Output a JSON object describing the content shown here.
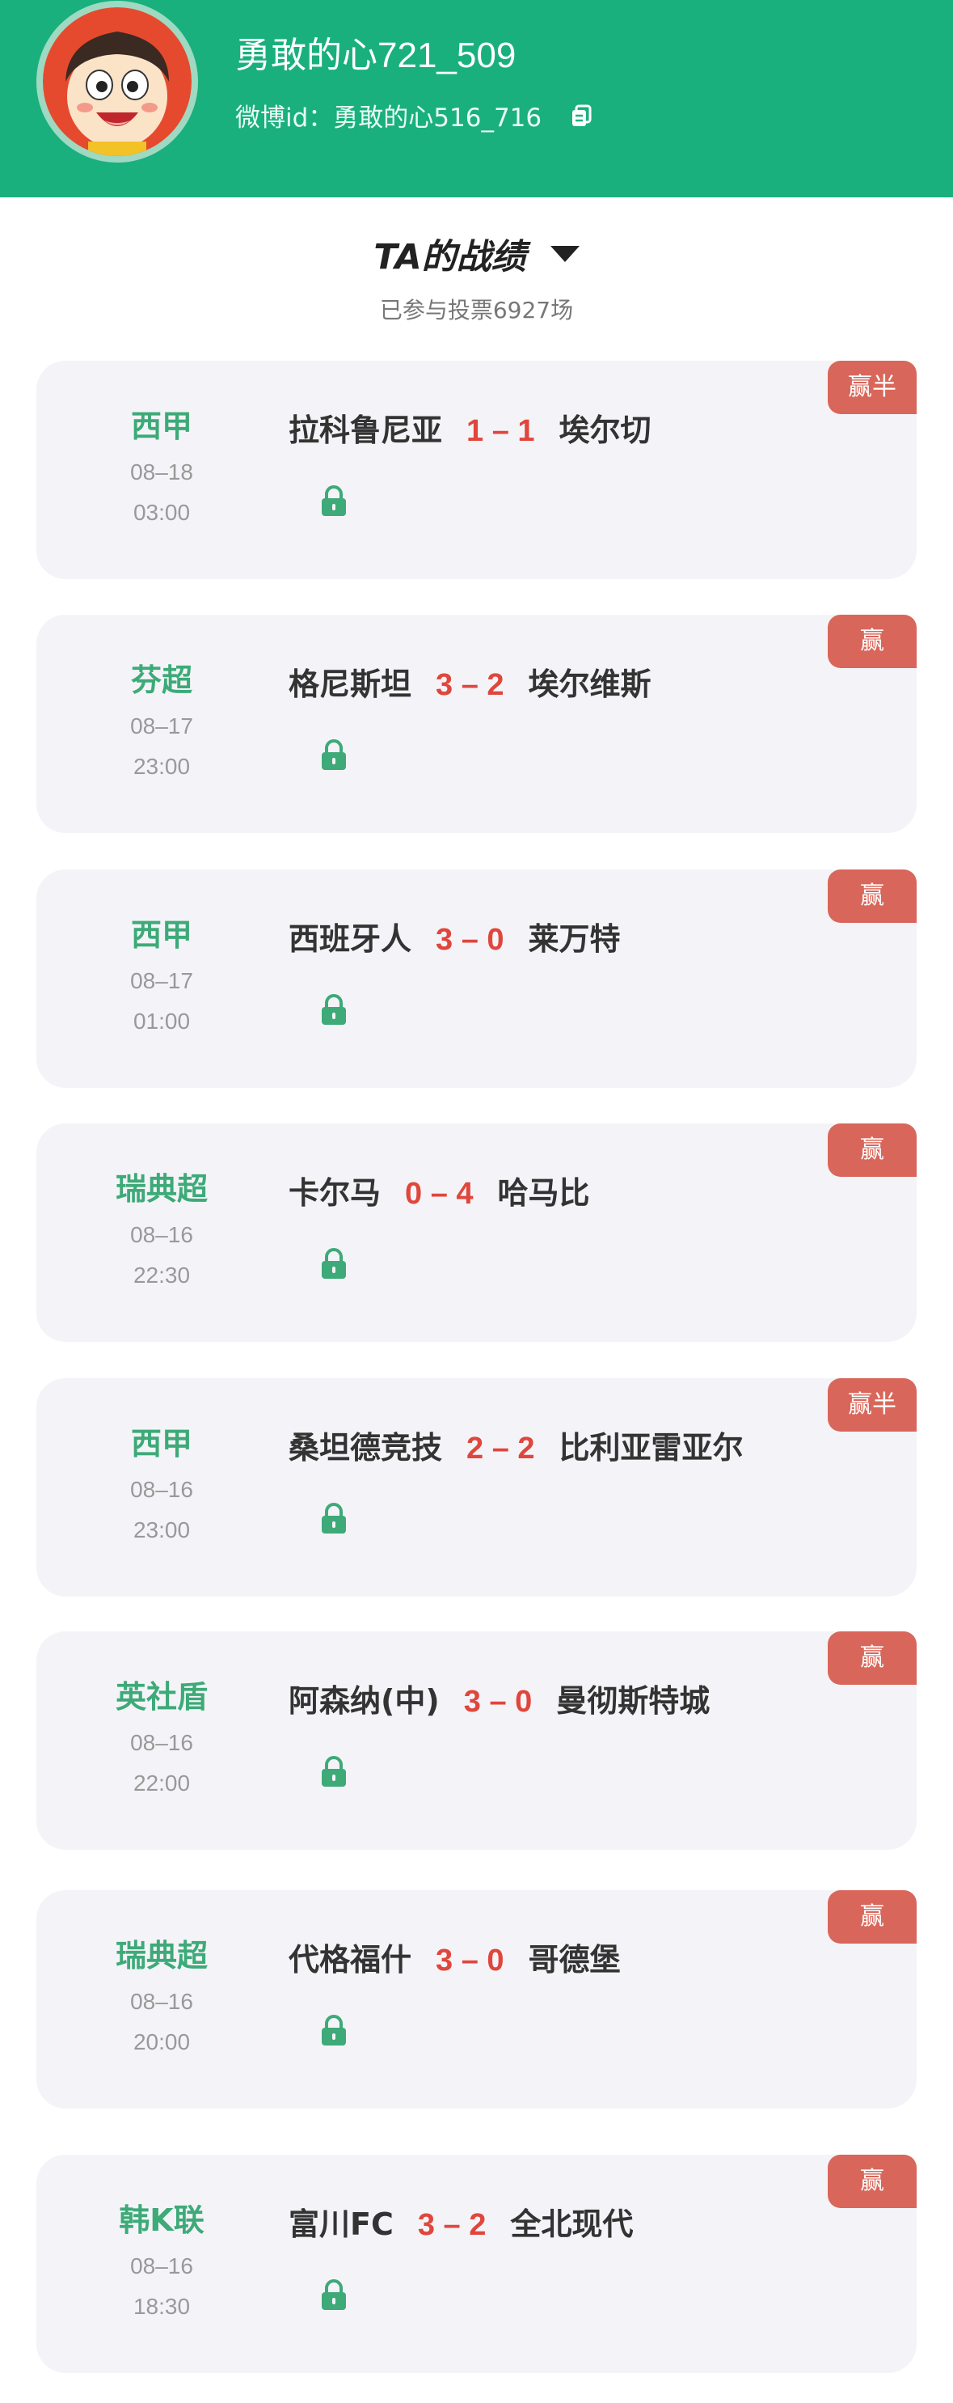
{
  "profile": {
    "username": "勇敢的心721_509",
    "weibo_id": "微博id：勇敢的心516_716",
    "avatar_icon": "cartoon-boy-avatar",
    "copy_icon": "copy-icon"
  },
  "section": {
    "title": "TA的战绩",
    "subtitle": "已参与投票6927场"
  },
  "colors": {
    "header_bg": "#19b07e",
    "league_text": "#3daa78",
    "score_text": "#e0463c",
    "badge_bg": "#d9665a",
    "card_bg": "#f4f4f8"
  },
  "matches": [
    {
      "league": "西甲",
      "date": "08–18",
      "time": "03:00",
      "home": "拉科鲁尼亚",
      "score": "1 – 1",
      "away": "埃尔切",
      "result": "赢半"
    },
    {
      "league": "芬超",
      "date": "08–17",
      "time": "23:00",
      "home": "格尼斯坦",
      "score": "3 – 2",
      "away": "埃尔维斯",
      "result": "赢"
    },
    {
      "league": "西甲",
      "date": "08–17",
      "time": "01:00",
      "home": "西班牙人",
      "score": "3 – 0",
      "away": "莱万特",
      "result": "赢"
    },
    {
      "league": "瑞典超",
      "date": "08–16",
      "time": "22:30",
      "home": "卡尔马",
      "score": "0 – 4",
      "away": "哈马比",
      "result": "赢"
    },
    {
      "league": "西甲",
      "date": "08–16",
      "time": "23:00",
      "home": "桑坦德竞技",
      "score": "2 – 2",
      "away": "比利亚雷亚尔",
      "result": "赢半"
    },
    {
      "league": "英社盾",
      "date": "08–16",
      "time": "22:00",
      "home": "阿森纳(中)",
      "score": "3 – 0",
      "away": "曼彻斯特城",
      "result": "赢"
    },
    {
      "league": "瑞典超",
      "date": "08–16",
      "time": "20:00",
      "home": "代格福什",
      "score": "3 – 0",
      "away": "哥德堡",
      "result": "赢"
    },
    {
      "league": "韩K联",
      "date": "08–16",
      "time": "18:30",
      "home": "富川FC",
      "score": "3 – 2",
      "away": "全北现代",
      "result": "赢"
    }
  ]
}
